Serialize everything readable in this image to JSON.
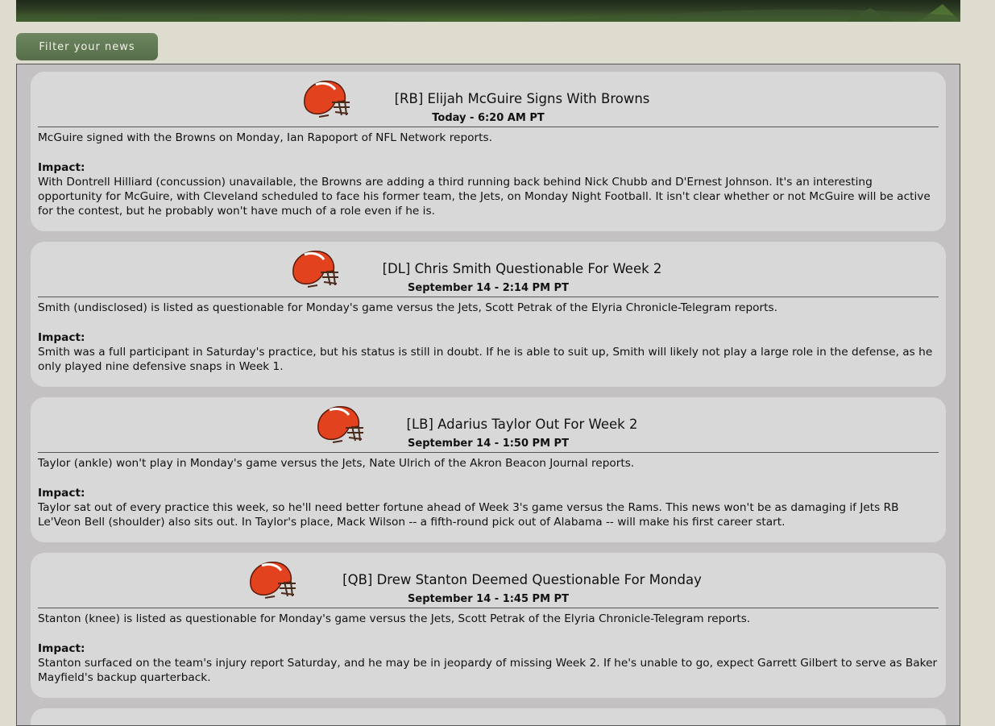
{
  "filter_button": "Filter your news",
  "news": [
    {
      "headline": "[RB] Elijah McGuire Signs With Browns",
      "time": "Today - 6:20 AM PT",
      "summary": "McGuire signed with the Browns on Monday, Ian Rapoport of NFL Network reports.",
      "impact_label": "Impact:",
      "impact": "With Dontrell Hilliard (concussion) unavailable, the Browns are adding a third running back behind Nick Chubb and D'Ernest Johnson. It's an interesting opportunity for McGuire, with Cleveland scheduled to face his former team, the Jets, on Monday Night Football. It isn't clear whether or not McGuire will be active for the contest, but he probably won't have much of a role even if he is."
    },
    {
      "headline": "[DL] Chris Smith Questionable For Week 2",
      "time": "September 14 - 2:14 PM PT",
      "summary": "Smith (undisclosed) is listed as questionable for Monday's game versus the Jets, Scott Petrak of the Elyria Chronicle-Telegram reports.",
      "impact_label": "Impact:",
      "impact": "Smith was a full participant in Saturday's practice, but his status is still in doubt. If he is able to suit up, Smith will likely not play a large role in the defense, as he only played nine defensive snaps in Week 1."
    },
    {
      "headline": "[LB] Adarius Taylor Out For Week 2",
      "time": "September 14 - 1:50 PM PT",
      "summary": "Taylor (ankle) won't play in Monday's game versus the Jets, Nate Ulrich of the Akron Beacon Journal reports.",
      "impact_label": "Impact:",
      "impact": "Taylor sat out of every practice this week, so he'll need better fortune ahead of Week 3's game versus the Rams. This news won't be as damaging if Jets RB Le'Veon Bell (shoulder) also sits out. In Taylor's place, Mack Wilson -- a fifth-round pick out of Alabama -- will make his first career start."
    },
    {
      "headline": "[QB] Drew Stanton Deemed Questionable For Monday",
      "time": "September 14 - 1:45 PM PT",
      "summary": "Stanton (knee) is listed as questionable for Monday's game versus the Jets, Scott Petrak of the Elyria Chronicle-Telegram reports.",
      "impact_label": "Impact:",
      "impact": "Stanton surfaced on the team's injury report Saturday, and he may be in jeopardy of missing Week 2. If he's unable to go, expect Garrett Gilbert to serve as Baker Mayfield's backup quarterback."
    }
  ],
  "helmet_icon": "browns-helmet-icon",
  "colors": {
    "page_bg": "#dedcce",
    "card_bg": "#d9d8d8",
    "feed_bg": "#c4c1c3",
    "button_bg": "#61795a",
    "helmet_orange": "#e2421e"
  }
}
